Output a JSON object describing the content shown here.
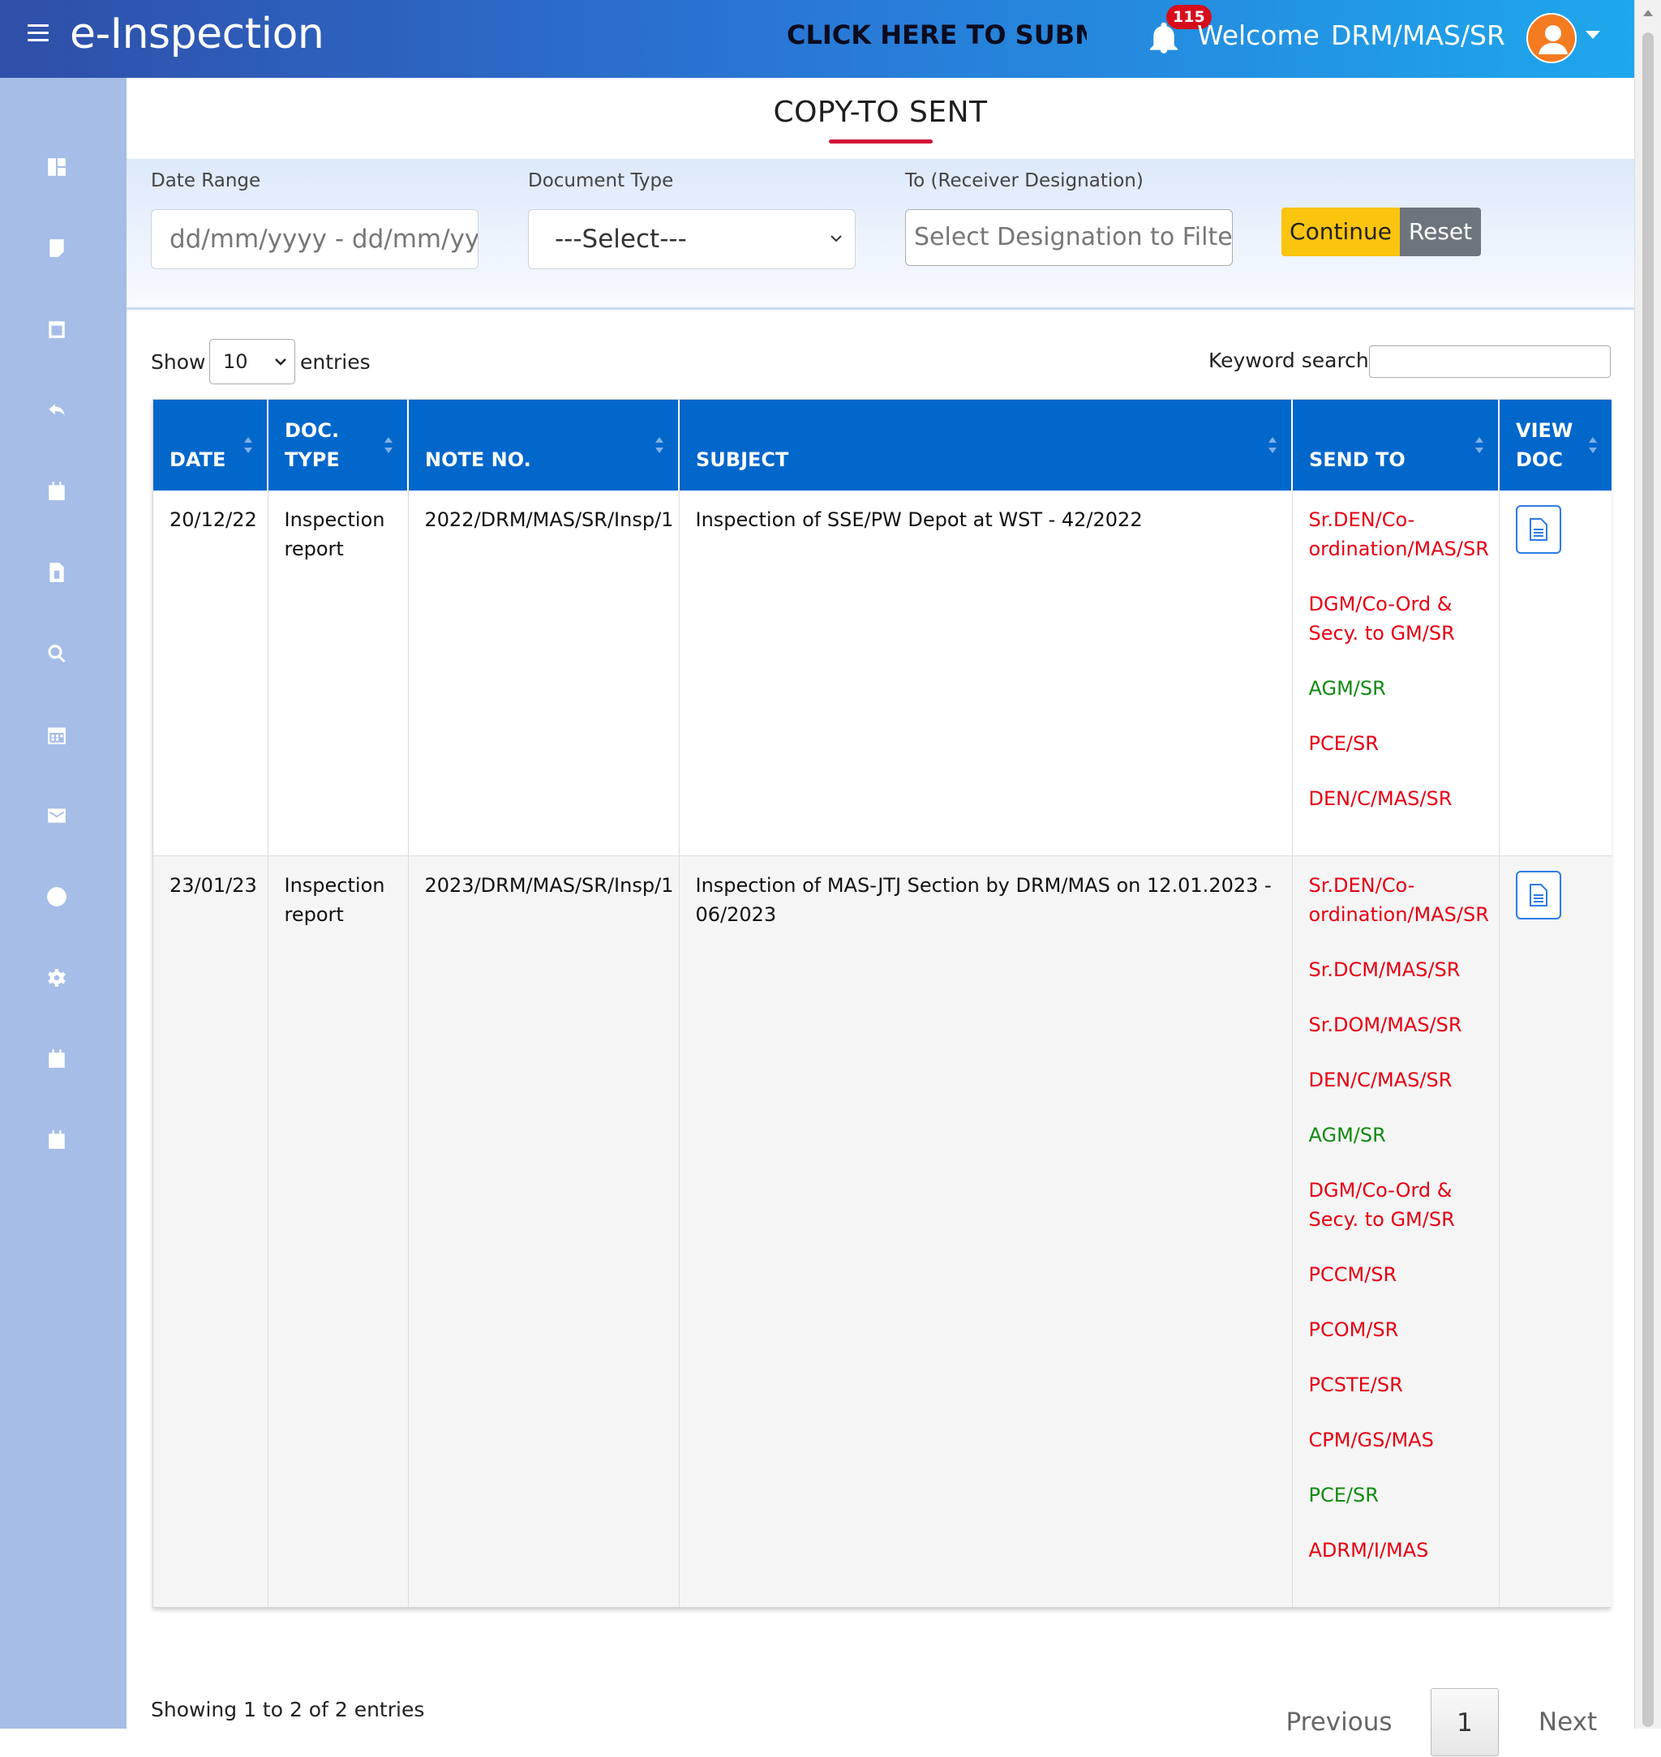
{
  "header": {
    "app_title": "e-Inspection",
    "marquee_text": "CLICK HERE TO SUBMIT '",
    "notification_count": "115",
    "welcome_label": "Welcome",
    "user_name": "DRM/MAS/SR"
  },
  "sidebar": {
    "icons": [
      "dashboard-icon",
      "bookmark-icon",
      "calendar-blank-icon",
      "reply-icon",
      "calendar-icon",
      "document-icon",
      "search-icon",
      "calendar-grid-icon",
      "mail-icon",
      "help-icon",
      "settings-icon",
      "calendar-note-icon",
      "calendar-clip-icon"
    ]
  },
  "page": {
    "title": "COPY-TO SENT"
  },
  "filters": {
    "date_range_label": "Date Range",
    "date_range_placeholder": "dd/mm/yyyy - dd/mm/yyyy",
    "document_type_label": "Document Type",
    "document_type_value": "---Select---",
    "receiver_label": "To (Receiver Designation)",
    "receiver_placeholder": "Select Designation to Filter",
    "continue_label": "Continue",
    "reset_label": "Reset"
  },
  "table_controls": {
    "show_label": "Show",
    "entries_value": "10",
    "entries_label": "entries",
    "keyword_label": "Keyword search:"
  },
  "table": {
    "headers": {
      "date": "DATE",
      "doc_type": "DOC. TYPE",
      "note_no": "NOTE NO.",
      "subject": "SUBJECT",
      "send_to": "SEND TO",
      "view_doc": "VIEW DOC"
    },
    "rows": [
      {
        "date": "20/12/22",
        "doc_type": "Inspection report",
        "note_no": "2022/DRM/MAS/SR/Insp/1",
        "subject": "Inspection of SSE/PW Depot at WST - 42/2022",
        "send_to": [
          {
            "name": "Sr.DEN/Co-ordination/MAS/SR",
            "status": "red"
          },
          {
            "name": "DGM/Co-Ord & Secy. to GM/SR",
            "status": "red"
          },
          {
            "name": "AGM/SR",
            "status": "green"
          },
          {
            "name": "PCE/SR",
            "status": "red"
          },
          {
            "name": "DEN/C/MAS/SR",
            "status": "red"
          }
        ]
      },
      {
        "date": "23/01/23",
        "doc_type": "Inspection report",
        "note_no": "2023/DRM/MAS/SR/Insp/1",
        "subject": "Inspection of MAS-JTJ Section by DRM/MAS on 12.01.2023 - 06/2023",
        "send_to": [
          {
            "name": "Sr.DEN/Co-ordination/MAS/SR",
            "status": "red"
          },
          {
            "name": "Sr.DCM/MAS/SR",
            "status": "red"
          },
          {
            "name": "Sr.DOM/MAS/SR",
            "status": "red"
          },
          {
            "name": "DEN/C/MAS/SR",
            "status": "red"
          },
          {
            "name": "AGM/SR",
            "status": "green"
          },
          {
            "name": "DGM/Co-Ord & Secy. to GM/SR",
            "status": "red"
          },
          {
            "name": "PCCM/SR",
            "status": "red"
          },
          {
            "name": "PCOM/SR",
            "status": "red"
          },
          {
            "name": "PCSTE/SR",
            "status": "red"
          },
          {
            "name": "CPM/GS/MAS",
            "status": "red"
          },
          {
            "name": "PCE/SR",
            "status": "green"
          },
          {
            "name": "ADRM/I/MAS",
            "status": "red"
          }
        ]
      }
    ]
  },
  "footer": {
    "info": "Showing 1 to 2 of 2 entries",
    "previous_label": "Previous",
    "current_page": "1",
    "next_label": "Next"
  },
  "colors": {
    "header_start": "#2f4fa8",
    "header_end": "#1ea7ec",
    "sidebar": "#a5bde7",
    "table_header": "#0167cb",
    "continue": "#fbc40e",
    "reset": "#6c757d",
    "title_underline": "#d2143a",
    "status_red": "#e60012",
    "status_green": "#108a10"
  }
}
